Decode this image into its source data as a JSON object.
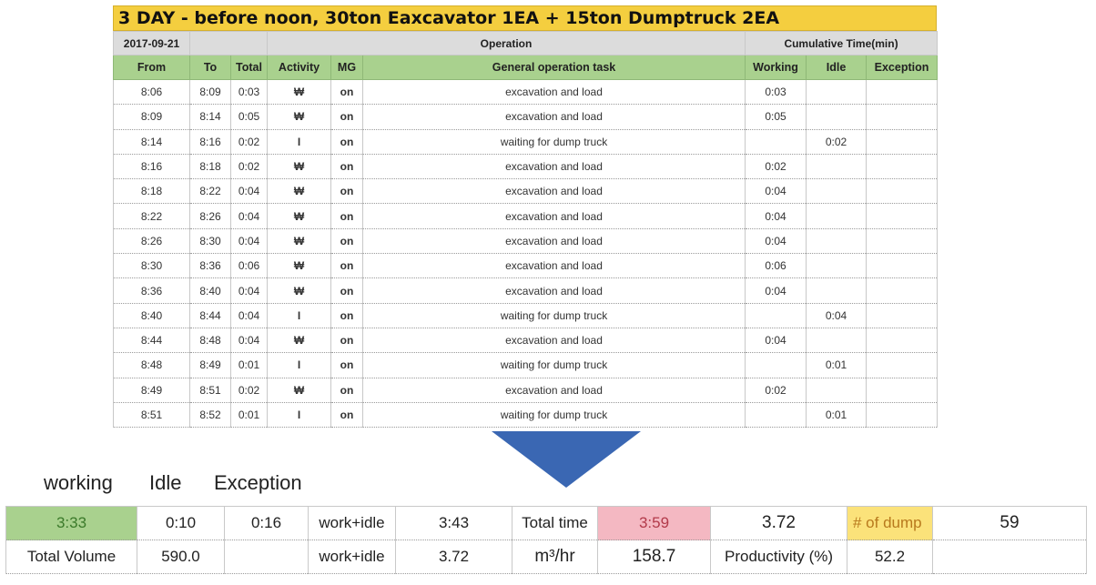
{
  "title": "3 DAY - before noon, 30ton Eaxcavator 1EA + 15ton Dumptruck 2EA",
  "header_row1": {
    "date": "2017-09-21",
    "operation": "Operation",
    "cumulative": "Cumulative Time(min)"
  },
  "columns": [
    "From",
    "To",
    "Total",
    "Activity",
    "MG",
    "General operation task",
    "Working",
    "Idle",
    "Exception"
  ],
  "rows": [
    {
      "from": "8:06",
      "to": "8:09",
      "total": "0:03",
      "activity": "W",
      "mg": "on",
      "task": "excavation and load",
      "working": "0:03",
      "idle": "",
      "exception": ""
    },
    {
      "from": "8:09",
      "to": "8:14",
      "total": "0:05",
      "activity": "W",
      "mg": "on",
      "task": "excavation and load",
      "working": "0:05",
      "idle": "",
      "exception": ""
    },
    {
      "from": "8:14",
      "to": "8:16",
      "total": "0:02",
      "activity": "I",
      "mg": "on",
      "task": "waiting for dump truck",
      "working": "",
      "idle": "0:02",
      "exception": ""
    },
    {
      "from": "8:16",
      "to": "8:18",
      "total": "0:02",
      "activity": "W",
      "mg": "on",
      "task": "excavation and load",
      "working": "0:02",
      "idle": "",
      "exception": ""
    },
    {
      "from": "8:18",
      "to": "8:22",
      "total": "0:04",
      "activity": "W",
      "mg": "on",
      "task": "excavation and load",
      "working": "0:04",
      "idle": "",
      "exception": ""
    },
    {
      "from": "8:22",
      "to": "8:26",
      "total": "0:04",
      "activity": "W",
      "mg": "on",
      "task": "excavation and load",
      "working": "0:04",
      "idle": "",
      "exception": ""
    },
    {
      "from": "8:26",
      "to": "8:30",
      "total": "0:04",
      "activity": "W",
      "mg": "on",
      "task": "excavation and load",
      "working": "0:04",
      "idle": "",
      "exception": ""
    },
    {
      "from": "8:30",
      "to": "8:36",
      "total": "0:06",
      "activity": "W",
      "mg": "on",
      "task": "excavation and load",
      "working": "0:06",
      "idle": "",
      "exception": ""
    },
    {
      "from": "8:36",
      "to": "8:40",
      "total": "0:04",
      "activity": "W",
      "mg": "on",
      "task": "excavation and load",
      "working": "0:04",
      "idle": "",
      "exception": ""
    },
    {
      "from": "8:40",
      "to": "8:44",
      "total": "0:04",
      "activity": "I",
      "mg": "on",
      "task": "waiting for dump truck",
      "working": "",
      "idle": "0:04",
      "exception": ""
    },
    {
      "from": "8:44",
      "to": "8:48",
      "total": "0:04",
      "activity": "W",
      "mg": "on",
      "task": "excavation and load",
      "working": "0:04",
      "idle": "",
      "exception": ""
    },
    {
      "from": "8:48",
      "to": "8:49",
      "total": "0:01",
      "activity": "I",
      "mg": "on",
      "task": "waiting for dump truck",
      "working": "",
      "idle": "0:01",
      "exception": ""
    },
    {
      "from": "8:49",
      "to": "8:51",
      "total": "0:02",
      "activity": "W",
      "mg": "on",
      "task": "excavation and load",
      "working": "0:02",
      "idle": "",
      "exception": ""
    },
    {
      "from": "8:51",
      "to": "8:52",
      "total": "0:01",
      "activity": "I",
      "mg": "on",
      "task": "waiting for dump truck",
      "working": "",
      "idle": "0:01",
      "exception": ""
    }
  ],
  "legend": {
    "working": "working",
    "idle": "Idle",
    "exception": "Exception"
  },
  "summary": {
    "working": "3:33",
    "idle": "0:10",
    "exception": "0:16",
    "work_idle_label": "work+idle",
    "work_idle_value": "3:43",
    "total_time_label": "Total time",
    "total_time_value": "3:59",
    "total_hours": "3.72",
    "dump_label": "# of dump",
    "dump_value": "59",
    "total_volume_label": "Total Volume",
    "total_volume_value": "590.0",
    "blank": "",
    "work_idle_label2": "work+idle",
    "work_idle_hours": "3.72",
    "rate_unit": "m³/hr",
    "rate_value": "158.7",
    "productivity_label": "Productivity (%)",
    "productivity_value": "52.2",
    "blank2": ""
  },
  "colors": {
    "title_bg": "#f4ce3f",
    "header_green": "#a9d18e",
    "work_red": "#d42020",
    "idle_blue": "#2f7fd0",
    "arrow_blue": "#3a67b3",
    "total_pink": "#f4b8c2",
    "dump_yellow": "#fbe27a"
  },
  "icons": {
    "arrow": "down-triangle-arrow-icon",
    "activity_work": "won-sign-icon"
  }
}
